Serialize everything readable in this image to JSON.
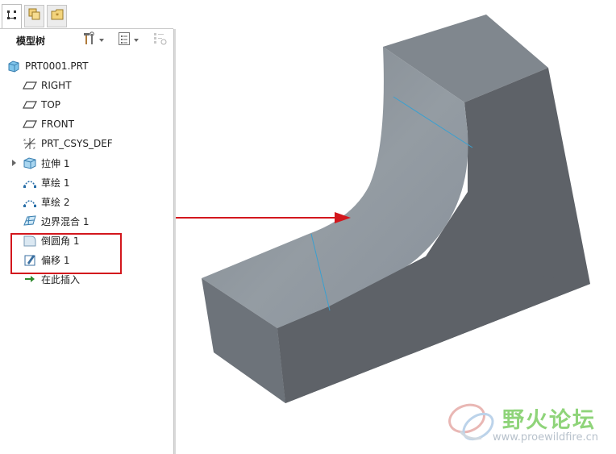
{
  "model_tree": {
    "tabs": [
      {
        "name": "model-tree-tab-icon"
      },
      {
        "name": "layers-tab-icon"
      },
      {
        "name": "favorites-tab-icon"
      }
    ],
    "title": "模型树",
    "toolbar": {
      "settings_icon": "hammer-wrench-icon",
      "show_icon": "list-icon",
      "filter_icon": "filter-icon"
    },
    "items": [
      {
        "label": "PRT0001.PRT",
        "icon": "part-icon"
      },
      {
        "label": "RIGHT",
        "icon": "datum-plane-icon"
      },
      {
        "label": "TOP",
        "icon": "datum-plane-icon"
      },
      {
        "label": "FRONT",
        "icon": "datum-plane-icon"
      },
      {
        "label": "PRT_CSYS_DEF",
        "icon": "coordinate-system-icon"
      },
      {
        "label": "拉伸 1",
        "icon": "extrude-icon"
      },
      {
        "label": "草绘 1",
        "icon": "sketch-icon"
      },
      {
        "label": "草绘 2",
        "icon": "sketch-icon"
      },
      {
        "label": "边界混合 1",
        "icon": "boundary-blend-icon"
      },
      {
        "label": "倒圆角 1",
        "icon": "round-icon"
      },
      {
        "label": "偏移 1",
        "icon": "offset-icon"
      },
      {
        "label": "在此插入",
        "icon": "insert-here-icon"
      }
    ]
  },
  "annotation": {
    "highlight_color": "#d3171d",
    "arrow_color": "#d3171d"
  },
  "watermark": {
    "chinese": "野火论坛",
    "url": "www.proewildfire.cn"
  },
  "colors": {
    "model_top": "#7f868c",
    "model_side": "#5d6167",
    "model_curve": "#8e969d",
    "edge_line": "#3aa0d0"
  }
}
